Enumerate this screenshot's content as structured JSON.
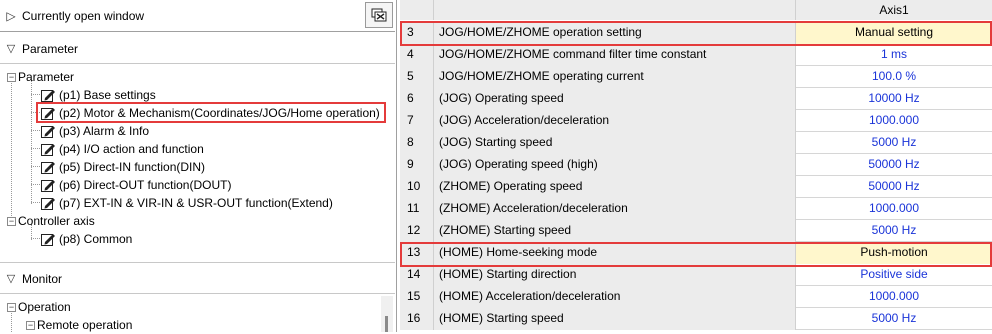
{
  "left": {
    "currently_open_window": "Currently open window",
    "parameter_section": "Parameter",
    "monitor_section": "Monitor",
    "tree": {
      "parameter_root": "Parameter",
      "items": [
        "(p1) Base settings",
        "(p2) Motor & Mechanism(Coordinates/JOG/Home operation)",
        "(p3) Alarm & Info",
        "(p4) I/O action and function",
        "(p5) Direct-IN function(DIN)",
        "(p6) Direct-OUT function(DOUT)",
        "(p7) EXT-IN & VIR-IN & USR-OUT function(Extend)"
      ],
      "controller_axis": "Controller axis",
      "common": "(p8) Common",
      "operation": "Operation",
      "remote_operation": "Remote operation"
    }
  },
  "grid": {
    "column_header": "Axis1",
    "rows": [
      {
        "num": "3",
        "name": "JOG/HOME/ZHOME operation setting",
        "value": "Manual setting"
      },
      {
        "num": "4",
        "name": "JOG/HOME/ZHOME command filter time constant",
        "value": "1 ms"
      },
      {
        "num": "5",
        "name": "JOG/HOME/ZHOME operating current",
        "value": "100.0 %"
      },
      {
        "num": "6",
        "name": "(JOG) Operating speed",
        "value": "10000 Hz"
      },
      {
        "num": "7",
        "name": "(JOG) Acceleration/deceleration",
        "value": "1000.000"
      },
      {
        "num": "8",
        "name": "(JOG) Starting speed",
        "value": "5000 Hz"
      },
      {
        "num": "9",
        "name": "(JOG) Operating speed (high)",
        "value": "50000 Hz"
      },
      {
        "num": "10",
        "name": "(ZHOME) Operating speed",
        "value": "50000 Hz"
      },
      {
        "num": "11",
        "name": "(ZHOME) Acceleration/deceleration",
        "value": "1000.000"
      },
      {
        "num": "12",
        "name": "(ZHOME) Starting speed",
        "value": "5000 Hz"
      },
      {
        "num": "13",
        "name": "(HOME) Home-seeking mode",
        "value": "Push-motion"
      },
      {
        "num": "14",
        "name": "(HOME) Starting direction",
        "value": "Positive side"
      },
      {
        "num": "15",
        "name": "(HOME) Acceleration/deceleration",
        "value": "1000.000"
      },
      {
        "num": "16",
        "name": "(HOME) Starting speed",
        "value": "5000 Hz"
      }
    ]
  },
  "colors": {
    "highlight_border": "#e43b3b",
    "value_text": "#1a34d8",
    "manual_cell_bg": "#fff7cc",
    "header_bg": "#ececec"
  }
}
